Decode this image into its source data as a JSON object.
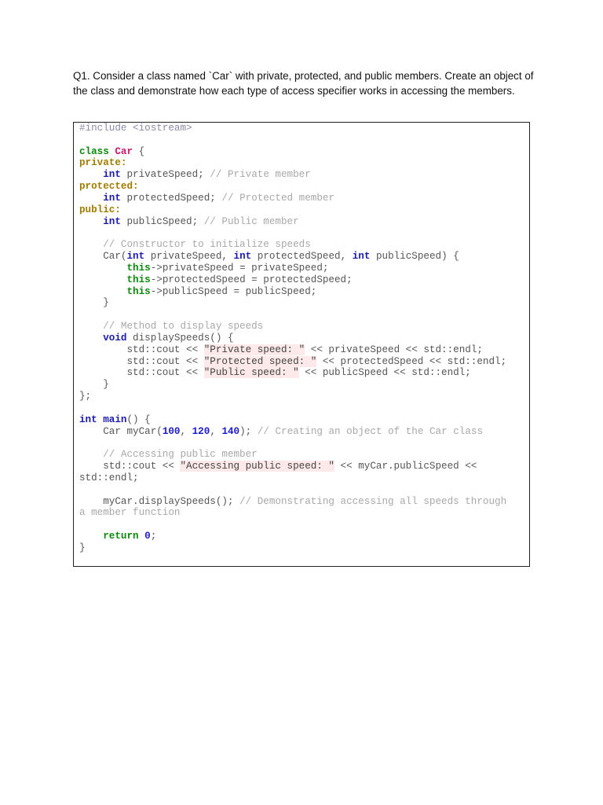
{
  "question": "Q1.  Consider a class named `Car` with private, protected, and public members. Create an object of the class and demonstrate how each type of access specifier works in accessing the members.",
  "colors": {
    "keyword": "#1a1ab0",
    "class": "#0a8a0a",
    "name": "#d0186e",
    "access": "#a07c00",
    "comment": "#a8a8a8",
    "string_bg": "#fde9e9",
    "number": "#1a1ad0"
  },
  "code_lines": [
    [
      [
        "#include <iostream>",
        "pre"
      ]
    ],
    [],
    [
      [
        "class",
        "cls"
      ],
      [
        " ",
        "txt"
      ],
      [
        "Car",
        "name"
      ],
      [
        " {",
        "txt"
      ]
    ],
    [
      [
        "private:",
        "acc"
      ]
    ],
    [
      [
        "    ",
        "txt"
      ],
      [
        "int",
        "kw"
      ],
      [
        " privateSpeed; ",
        "txt"
      ],
      [
        "// Private member",
        "cmt"
      ]
    ],
    [
      [
        "protected:",
        "acc"
      ]
    ],
    [
      [
        "    ",
        "txt"
      ],
      [
        "int",
        "kw"
      ],
      [
        " protectedSpeed; ",
        "txt"
      ],
      [
        "// Protected member",
        "cmt"
      ]
    ],
    [
      [
        "public:",
        "acc"
      ]
    ],
    [
      [
        "    ",
        "txt"
      ],
      [
        "int",
        "kw"
      ],
      [
        " publicSpeed; ",
        "txt"
      ],
      [
        "// Public member",
        "cmt"
      ]
    ],
    [],
    [
      [
        "    ",
        "txt"
      ],
      [
        "// Constructor to initialize speeds",
        "cmt"
      ]
    ],
    [
      [
        "    Car(",
        "txt"
      ],
      [
        "int",
        "kw"
      ],
      [
        " privateSpeed, ",
        "txt"
      ],
      [
        "int",
        "kw"
      ],
      [
        " protectedSpeed, ",
        "txt"
      ],
      [
        "int",
        "kw"
      ],
      [
        " publicSpeed) {",
        "txt"
      ]
    ],
    [
      [
        "        ",
        "txt"
      ],
      [
        "this",
        "this"
      ],
      [
        "->privateSpeed = privateSpeed;",
        "txt"
      ]
    ],
    [
      [
        "        ",
        "txt"
      ],
      [
        "this",
        "this"
      ],
      [
        "->protectedSpeed = protectedSpeed;",
        "txt"
      ]
    ],
    [
      [
        "        ",
        "txt"
      ],
      [
        "this",
        "this"
      ],
      [
        "->publicSpeed = publicSpeed;",
        "txt"
      ]
    ],
    [
      [
        "    }",
        "txt"
      ]
    ],
    [],
    [
      [
        "    ",
        "txt"
      ],
      [
        "// Method to display speeds",
        "cmt"
      ]
    ],
    [
      [
        "    ",
        "txt"
      ],
      [
        "void",
        "kw"
      ],
      [
        " displaySpeeds() {",
        "txt"
      ]
    ],
    [
      [
        "        std::cout << ",
        "txt"
      ],
      [
        "\"Private speed: \"",
        "str"
      ],
      [
        " << privateSpeed << std::endl;",
        "txt"
      ]
    ],
    [
      [
        "        std::cout << ",
        "txt"
      ],
      [
        "\"Protected speed: \"",
        "str"
      ],
      [
        " << protectedSpeed << std::endl;",
        "txt"
      ]
    ],
    [
      [
        "        std::cout << ",
        "txt"
      ],
      [
        "\"Public speed: \"",
        "str"
      ],
      [
        " << publicSpeed << std::endl;",
        "txt"
      ]
    ],
    [
      [
        "    }",
        "txt"
      ]
    ],
    [
      [
        "};",
        "txt"
      ]
    ],
    [],
    [
      [
        "int",
        "kw"
      ],
      [
        " ",
        "txt"
      ],
      [
        "main",
        "kw"
      ],
      [
        "() {",
        "txt"
      ]
    ],
    [
      [
        "    Car myCar(",
        "txt"
      ],
      [
        "100",
        "num"
      ],
      [
        ", ",
        "txt"
      ],
      [
        "120",
        "num"
      ],
      [
        ", ",
        "txt"
      ],
      [
        "140",
        "num"
      ],
      [
        "); ",
        "txt"
      ],
      [
        "// Creating an object of the Car class",
        "cmt"
      ]
    ],
    [],
    [
      [
        "    ",
        "txt"
      ],
      [
        "// Accessing public member",
        "cmt"
      ]
    ],
    [
      [
        "    std::cout << ",
        "txt"
      ],
      [
        "\"Accessing public speed: \"",
        "str"
      ],
      [
        " << myCar.publicSpeed <<",
        "txt"
      ]
    ],
    [
      [
        "std::endl;",
        "txt"
      ]
    ],
    [],
    [
      [
        "    myCar.displaySpeeds(); ",
        "txt"
      ],
      [
        "// Demonstrating accessing all speeds through",
        "cmt"
      ]
    ],
    [
      [
        "a member function",
        "cmt"
      ]
    ],
    [],
    [
      [
        "    ",
        "txt"
      ],
      [
        "return",
        "this"
      ],
      [
        " ",
        "txt"
      ],
      [
        "0",
        "num"
      ],
      [
        ";",
        "txt"
      ]
    ],
    [
      [
        "}",
        "txt"
      ]
    ]
  ]
}
